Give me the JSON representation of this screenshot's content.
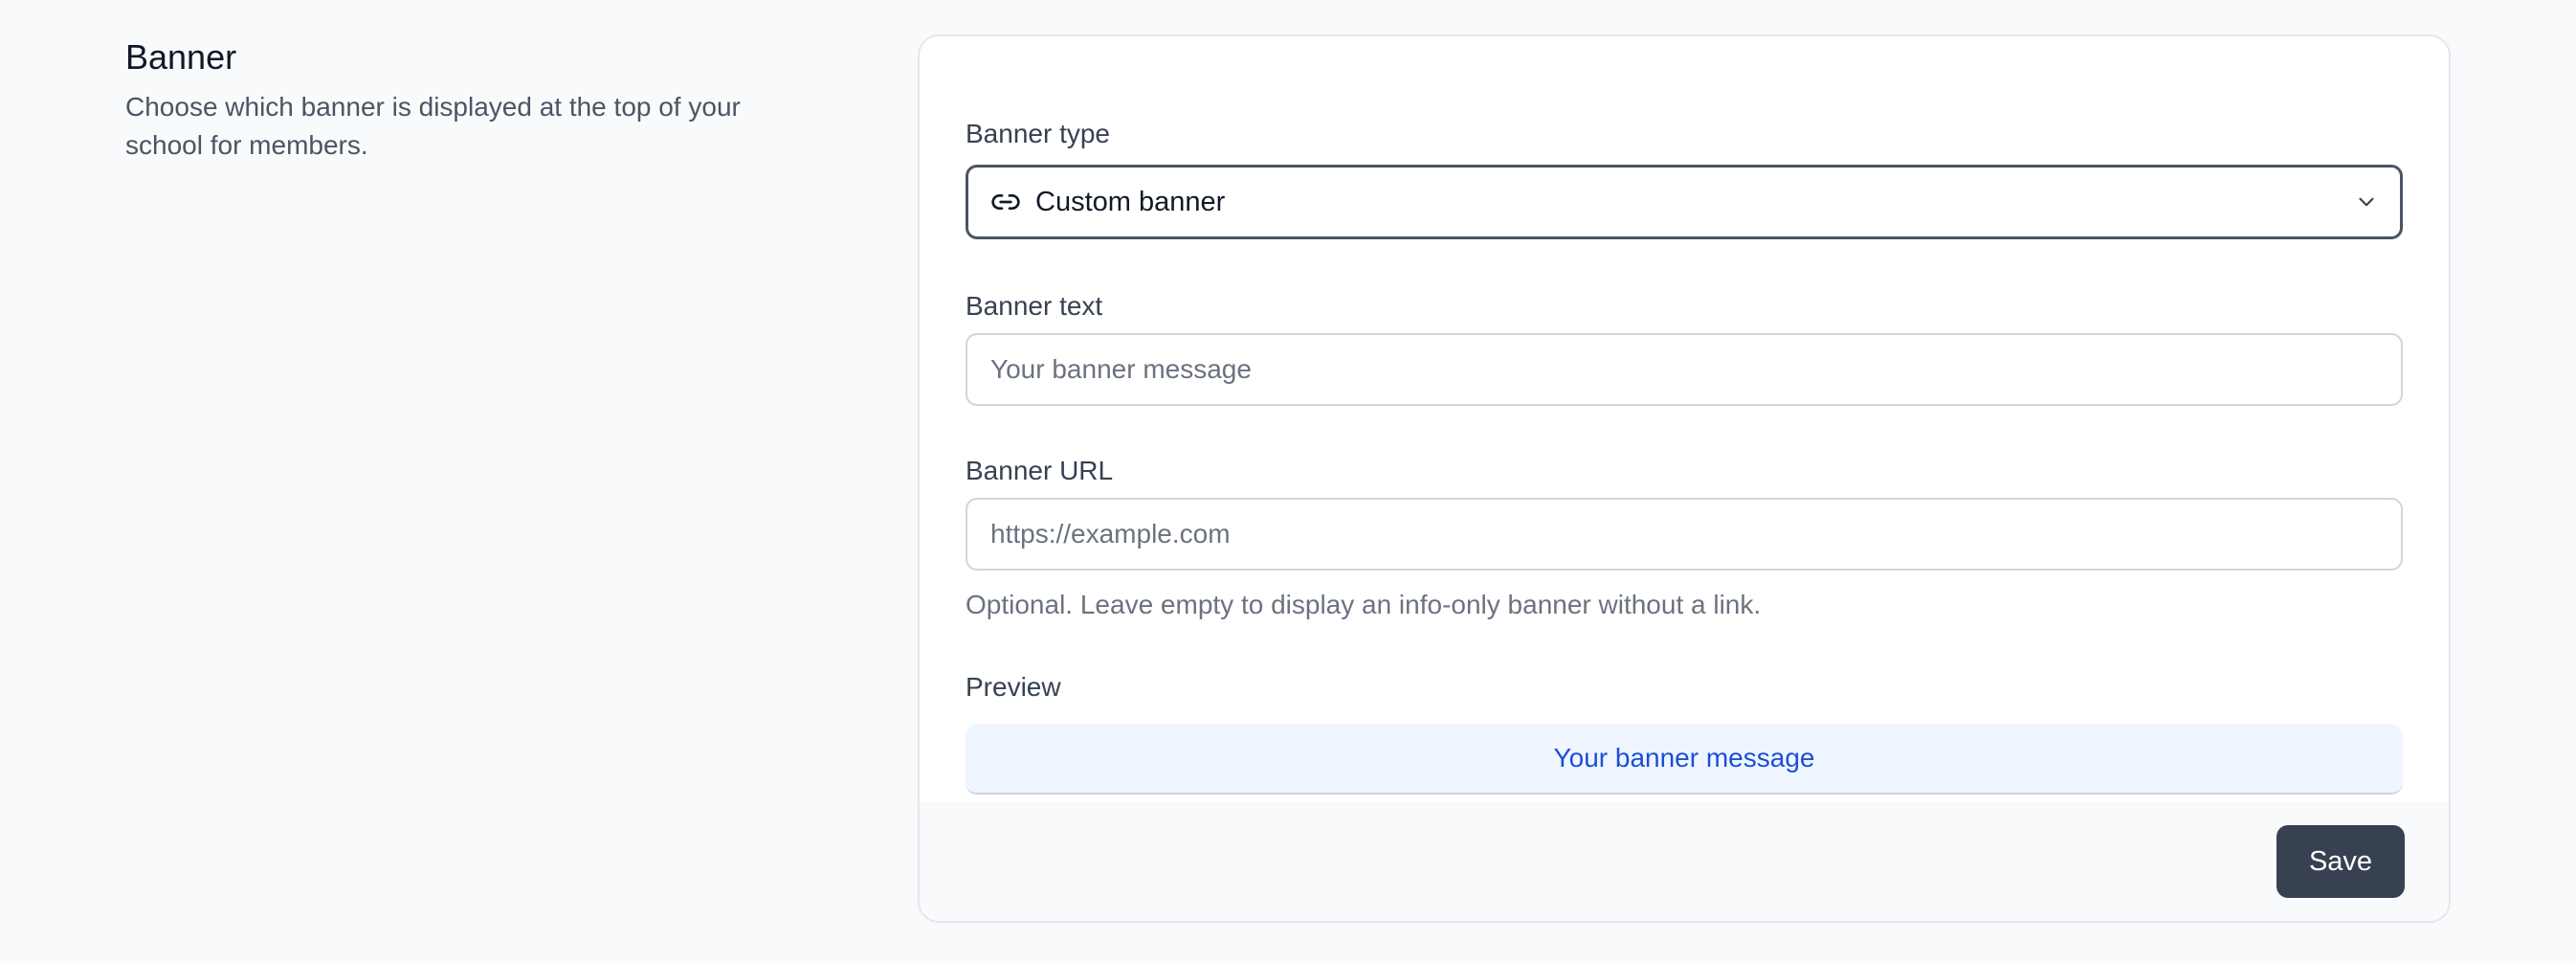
{
  "section": {
    "title": "Banner",
    "description": "Choose which banner is displayed at the top of your school for members."
  },
  "form": {
    "banner_type": {
      "label": "Banner type",
      "value": "Custom banner",
      "icon": "link-icon"
    },
    "banner_text": {
      "label": "Banner text",
      "value": "",
      "placeholder": "Your banner message"
    },
    "banner_url": {
      "label": "Banner URL",
      "value": "",
      "placeholder": "https://example.com",
      "help": "Optional. Leave empty to display an info-only banner without a link."
    },
    "preview": {
      "label": "Preview",
      "text": "Your banner message"
    }
  },
  "footer": {
    "save_label": "Save"
  },
  "colors": {
    "page_bg": "#f8fafc",
    "card_bg": "#ffffff",
    "select_border": "#4b5563",
    "preview_bg": "#eff6ff",
    "preview_text": "#1d4ed8",
    "save_bg": "#374151"
  }
}
